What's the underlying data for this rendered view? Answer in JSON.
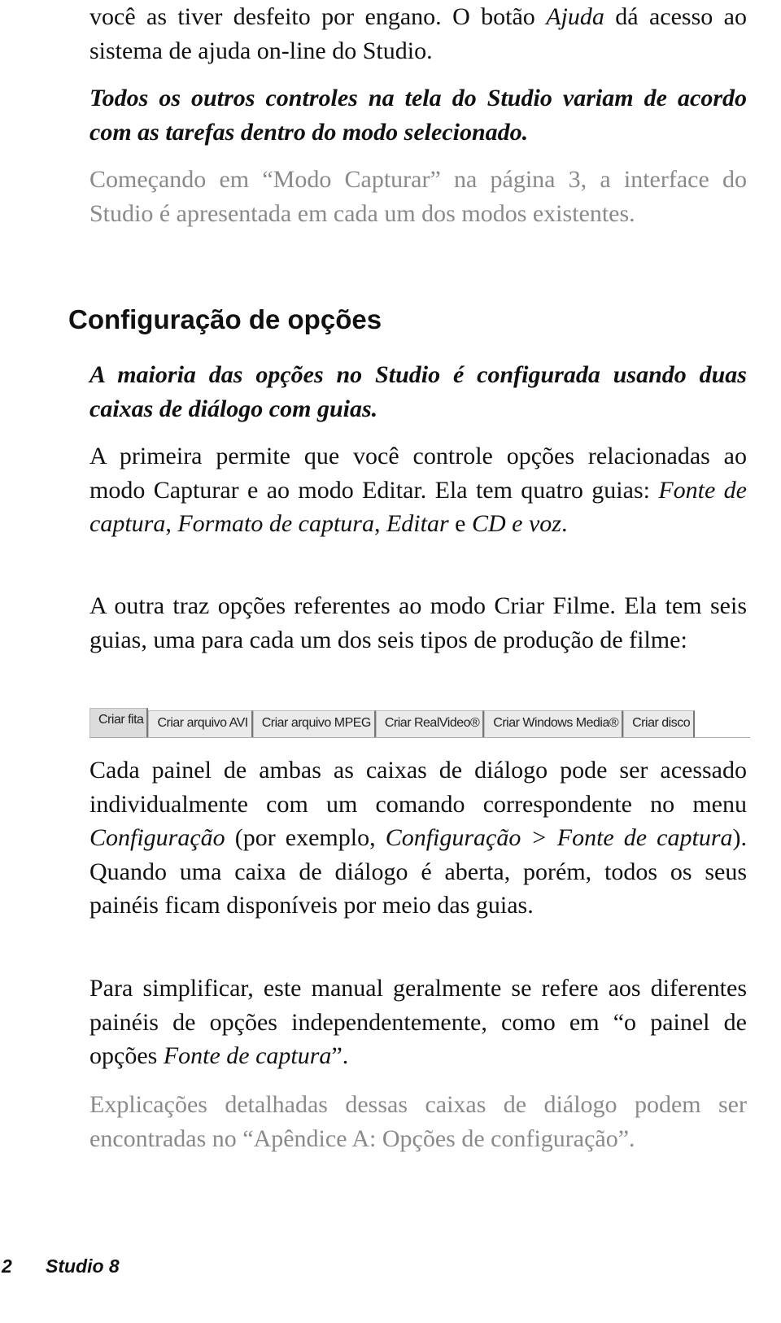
{
  "p1": {
    "a": "você as tiver desfeito por engano. O botão ",
    "b": "Ajuda",
    "c": " dá acesso ao sistema de ajuda on-line do Studio."
  },
  "p2": "Todos os outros controles na tela do Studio variam de acordo com as tarefas dentro do modo selecionado.",
  "p3": "Começando em “Modo Capturar” na página 3, a interface do Studio é apresentada em cada um dos modos existentes.",
  "heading": "Configuração de opções",
  "p4": "A maioria das opções no Studio é configurada usando duas caixas de diálogo com guias.",
  "p5": {
    "a": "A primeira permite que você controle opções relacionadas ao modo Capturar e ao modo Editar. Ela tem quatro guias: ",
    "b": "Fonte de captura",
    "c": ", ",
    "d": "Formato de captura",
    "e": ", ",
    "f": "Editar",
    "g": " e ",
    "h": "CD e voz",
    "i": "."
  },
  "p6": "A outra traz opções referentes ao modo Criar Filme. Ela tem seis guias, uma para cada um dos seis tipos de produção de filme:",
  "tabs": [
    {
      "label": "Criar fita",
      "active": true
    },
    {
      "label": "Criar arquivo AVI"
    },
    {
      "label": "Criar arquivo MPEG"
    },
    {
      "label": "Criar RealVideo®"
    },
    {
      "label": "Criar Windows Media®"
    },
    {
      "label": "Criar disco"
    }
  ],
  "p7": {
    "a": "Cada painel de ambas as caixas de diálogo pode ser acessado individualmente com um comando correspondente no menu ",
    "b": "Configuração",
    "c": " (por exemplo, ",
    "d": "Configuração > Fonte de captura",
    "e": "). Quando uma caixa de diálogo é aberta, porém, todos os seus painéis ficam disponíveis por meio das guias."
  },
  "p8": {
    "a": "Para simplificar, este manual geralmente se refere aos diferentes painéis de opções independentemente, como em “o painel de opções ",
    "b": "Fonte de captura",
    "c": "”."
  },
  "p9": "Explicações detalhadas dessas caixas de diálogo podem ser encontradas no “Apêndice A: Opções de configuração”.",
  "footer": {
    "page": "2",
    "title": "Studio 8"
  }
}
